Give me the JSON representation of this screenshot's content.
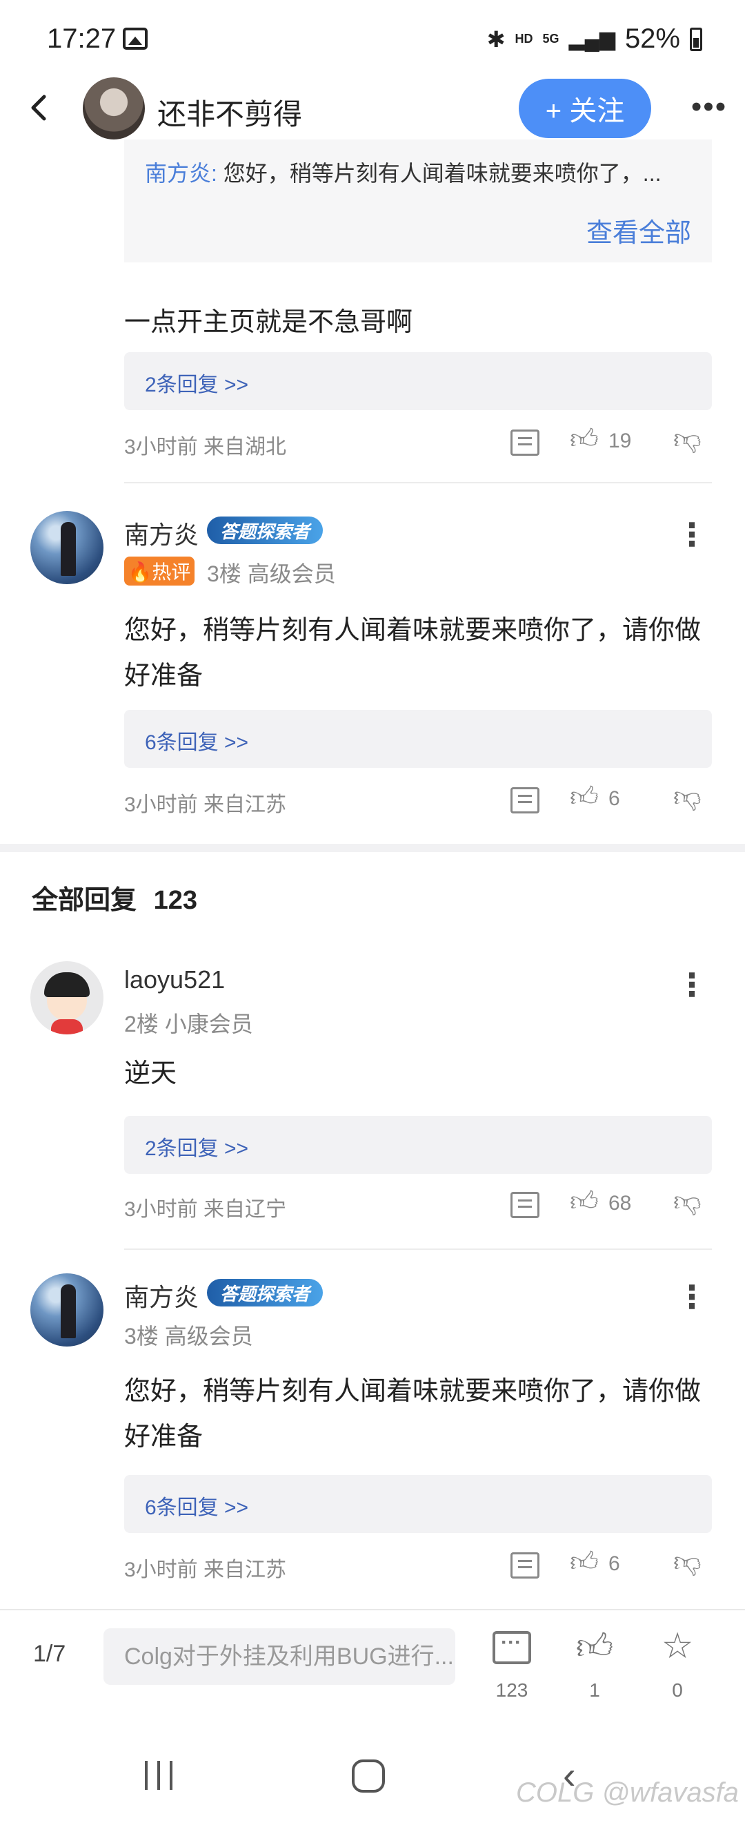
{
  "status_bar": {
    "time": "17:27",
    "network": "HD",
    "signal": "5G",
    "battery": "52%"
  },
  "header": {
    "title": "还非不剪得",
    "follow_label": "+ 关注",
    "more_label": "•••"
  },
  "quote": {
    "author": "南方炎:",
    "text": "您好，稍等片刻有人闻着味就要来喷你了，...",
    "view_all": "查看全部"
  },
  "top_comments": [
    {
      "body": "一点开主页就是不急哥啊",
      "replies": "2条回复 >>",
      "time": "3小时前 来自湖北",
      "likes": "19"
    },
    {
      "name": "南方炎",
      "badge": "答题探索者",
      "hot": "🔥热评",
      "meta": "3楼 高级会员",
      "body": "您好，稍等片刻有人闻着味就要来喷你了，请你做好准备",
      "replies": "6条回复 >>",
      "time": "3小时前 来自江苏",
      "likes": "6"
    }
  ],
  "all_replies": {
    "title": "全部回复",
    "count": "123",
    "items": [
      {
        "name": "laoyu521",
        "meta": "2楼 小康会员",
        "body": "逆天",
        "replies": "2条回复 >>",
        "time": "3小时前 来自辽宁",
        "likes": "68"
      },
      {
        "name": "南方炎",
        "badge": "答题探索者",
        "meta": "3楼 高级会员",
        "body": "您好，稍等片刻有人闻着味就要来喷你了，请你做好准备",
        "replies": "6条回复 >>",
        "time": "3小时前 来自江苏",
        "likes": "6"
      }
    ]
  },
  "bottom_bar": {
    "page": "1/7",
    "input_placeholder": "Colg对于外挂及利用BUG进行...",
    "comment_count": "123",
    "like_count": "1",
    "fav_count": "0"
  },
  "watermark": "COLG @wfavasfa",
  "icons": {
    "like": "thumbs-up-icon",
    "dislike": "thumbs-down-icon",
    "comment": "comment-icon",
    "star": "star-icon"
  },
  "colors": {
    "accent": "#4d8ff7",
    "link": "#4a7ed9",
    "hot": "#f5822a"
  }
}
